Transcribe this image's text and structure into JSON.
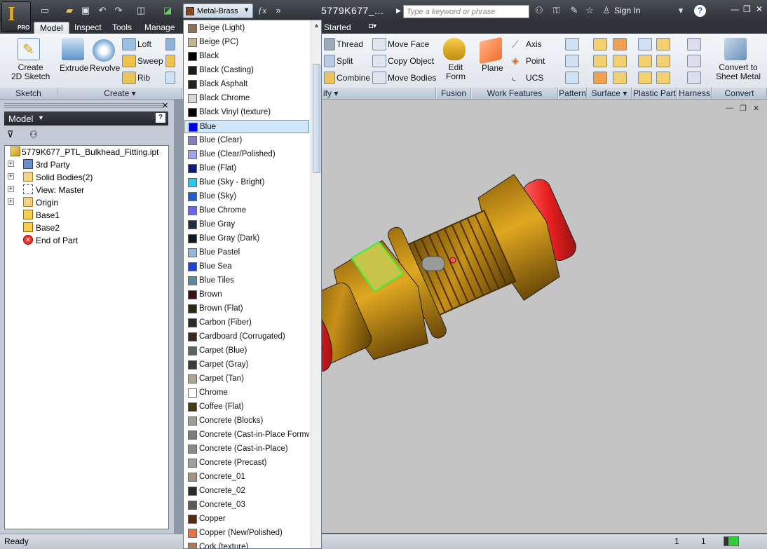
{
  "app": {
    "edition": "PRO",
    "document_title": "5779K677_...",
    "search_placeholder": "Type a keyword or phrase",
    "sign_in": "Sign In"
  },
  "material_dropdown": {
    "selected": "Metal-Brass",
    "selected_color": "#8a4a1e",
    "highlighted": "Blue",
    "options": [
      {
        "name": "Beige (Light)",
        "color": "#8c7355"
      },
      {
        "name": "Beige (PC)",
        "color": "#c6b58e"
      },
      {
        "name": "Black",
        "color": "#000000"
      },
      {
        "name": "Black (Casting)",
        "color": "#1b1b1b"
      },
      {
        "name": "Black Asphalt",
        "color": "#222222"
      },
      {
        "name": "Black Chrome",
        "color": "#d7d7d7"
      },
      {
        "name": "Black Vinyl (texture)",
        "color": "#050505"
      },
      {
        "name": "Blue",
        "color": "#0000e0"
      },
      {
        "name": "Blue (Clear)",
        "color": "#7f80c6"
      },
      {
        "name": "Blue (Clear/Polished)",
        "color": "#9fa6f0"
      },
      {
        "name": "Blue (Flat)",
        "color": "#0a1a80"
      },
      {
        "name": "Blue (Sky - Bright)",
        "color": "#22ccf4"
      },
      {
        "name": "Blue (Sky)",
        "color": "#1f5fd6"
      },
      {
        "name": "Blue Chrome",
        "color": "#6666ff"
      },
      {
        "name": "Blue Gray",
        "color": "#1e2e3e"
      },
      {
        "name": "Blue Gray (Dark)",
        "color": "#101a26"
      },
      {
        "name": "Blue Pastel",
        "color": "#90b8de"
      },
      {
        "name": "Blue Sea",
        "color": "#1a44e0"
      },
      {
        "name": "Blue Tiles",
        "color": "#5a8aa0"
      },
      {
        "name": "Brown",
        "color": "#3a1010"
      },
      {
        "name": "Brown (Flat)",
        "color": "#2e2a10"
      },
      {
        "name": "Carbon (Fiber)",
        "color": "#2a2a2a"
      },
      {
        "name": "Cardboard (Corrugated)",
        "color": "#3a2a1a"
      },
      {
        "name": "Carpet (Blue)",
        "color": "#5a6464"
      },
      {
        "name": "Carpet (Gray)",
        "color": "#3a3e3a"
      },
      {
        "name": "Carpet (Tan)",
        "color": "#b0a48a"
      },
      {
        "name": "Chrome",
        "color": "#ffffff"
      },
      {
        "name": "Coffee (Flat)",
        "color": "#4a3a10"
      },
      {
        "name": "Concrete (Blocks)",
        "color": "#9aa090"
      },
      {
        "name": "Concrete (Cast-in-Place Formwork)",
        "color": "#7a7e76"
      },
      {
        "name": "Concrete (Cast-in-Place)",
        "color": "#8a8a86"
      },
      {
        "name": "Concrete (Precast)",
        "color": "#a0a09a"
      },
      {
        "name": "Concrete_01",
        "color": "#a89080"
      },
      {
        "name": "Concrete_02",
        "color": "#2a2a2a"
      },
      {
        "name": "Concrete_03",
        "color": "#5e5a52"
      },
      {
        "name": "Copper",
        "color": "#5a2a10"
      },
      {
        "name": "Copper (New/Polished)",
        "color": "#f07040"
      },
      {
        "name": "Cork (texture)",
        "color": "#b07a40"
      }
    ]
  },
  "tabs": [
    "Model",
    "Inspect",
    "Tools",
    "Manage",
    "Started"
  ],
  "ribbon": {
    "sketch": {
      "create_2d_sketch": "Create\n2D Sketch",
      "panel": "Sketch"
    },
    "create": {
      "extrude": "Extrude",
      "revolve": "Revolve",
      "loft": "Loft",
      "sweep": "Sweep",
      "rib": "Rib",
      "panel": "Create"
    },
    "modify": {
      "thread": "Thread",
      "split": "Split",
      "combine": "Combine",
      "move_face": "Move Face",
      "copy_object": "Copy Object",
      "move_bodies": "Move Bodies",
      "panel": "ify"
    },
    "fusion": {
      "edit_form": "Edit\nForm",
      "panel": "Fusion"
    },
    "work_features": {
      "plane": "Plane",
      "axis": "Axis",
      "point": "Point",
      "ucs": "UCS",
      "panel": "Work Features"
    },
    "panels": {
      "pattern": "Pattern",
      "surface": "Surface",
      "plastic_part": "Plastic Part",
      "harness": "Harness"
    },
    "convert": {
      "convert_to_sheet_metal": "Convert to\nSheet Metal",
      "panel": "Convert"
    }
  },
  "browser": {
    "title": "Model",
    "items": [
      {
        "label": "5779K677_PTL_Bulkhead_Fitting.ipt",
        "expandable": false
      },
      {
        "label": "3rd Party",
        "expandable": true
      },
      {
        "label": "Solid Bodies(2)",
        "expandable": true
      },
      {
        "label": "View: Master",
        "expandable": true
      },
      {
        "label": "Origin",
        "expandable": true
      },
      {
        "label": "Base1",
        "expandable": false
      },
      {
        "label": "Base2",
        "expandable": false
      },
      {
        "label": "End of Part",
        "expandable": false
      }
    ]
  },
  "status": {
    "text": "Ready",
    "count1": "1",
    "count2": "1"
  }
}
